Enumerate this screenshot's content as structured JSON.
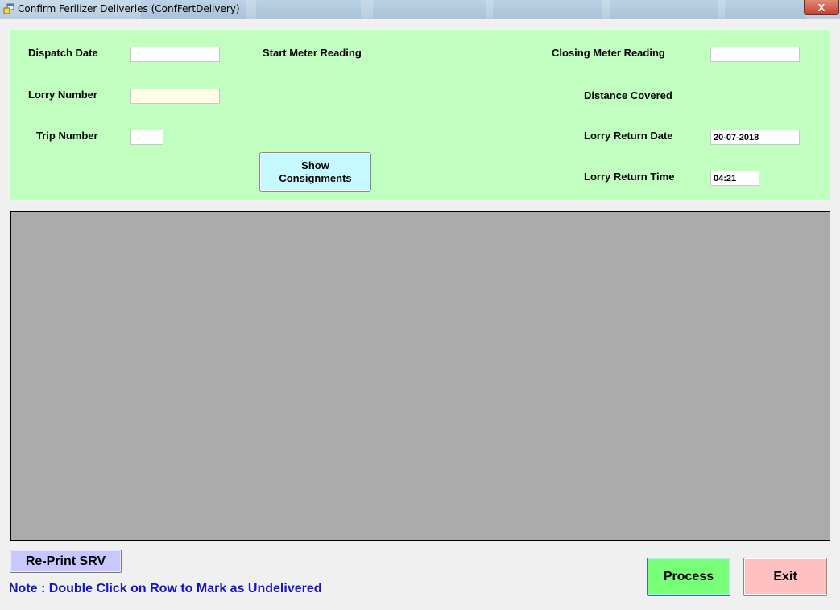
{
  "window": {
    "title": "Confirm Ferilizer Deliveries (ConfFertDelivery)",
    "close_glyph": "X"
  },
  "form": {
    "dispatch_date_label": "Dispatch Date",
    "dispatch_date_value": "",
    "lorry_number_label": "Lorry Number",
    "lorry_number_value": "",
    "trip_number_label": "Trip Number",
    "trip_number_value": "",
    "start_meter_label": "Start Meter Reading",
    "closing_meter_label": "Closing Meter Reading",
    "closing_meter_value": "",
    "distance_covered_label": "Distance Covered",
    "lorry_return_date_label": "Lorry Return Date",
    "lorry_return_date_value": "20-07-2018",
    "lorry_return_time_label": "Lorry Return Time",
    "lorry_return_time_value": "04:21",
    "show_consignments_line1": "Show",
    "show_consignments_line2": "Consignments"
  },
  "footer": {
    "reprint_label": "Re-Print SRV",
    "note": "Note : Double Click on Row to Mark as Undelivered",
    "process_label": "Process",
    "exit_label": "Exit"
  },
  "colors": {
    "form_bg": "#c0ffc0",
    "grid_bg": "#ababab",
    "note_text": "#1414c8",
    "process_bg": "#78ff78",
    "exit_bg": "#ffc0c0",
    "show_bg": "#c6f9ff",
    "reprint_bg": "#c8c8ff"
  },
  "icons": {
    "app": "app-window-icon",
    "close": "close-icon"
  }
}
